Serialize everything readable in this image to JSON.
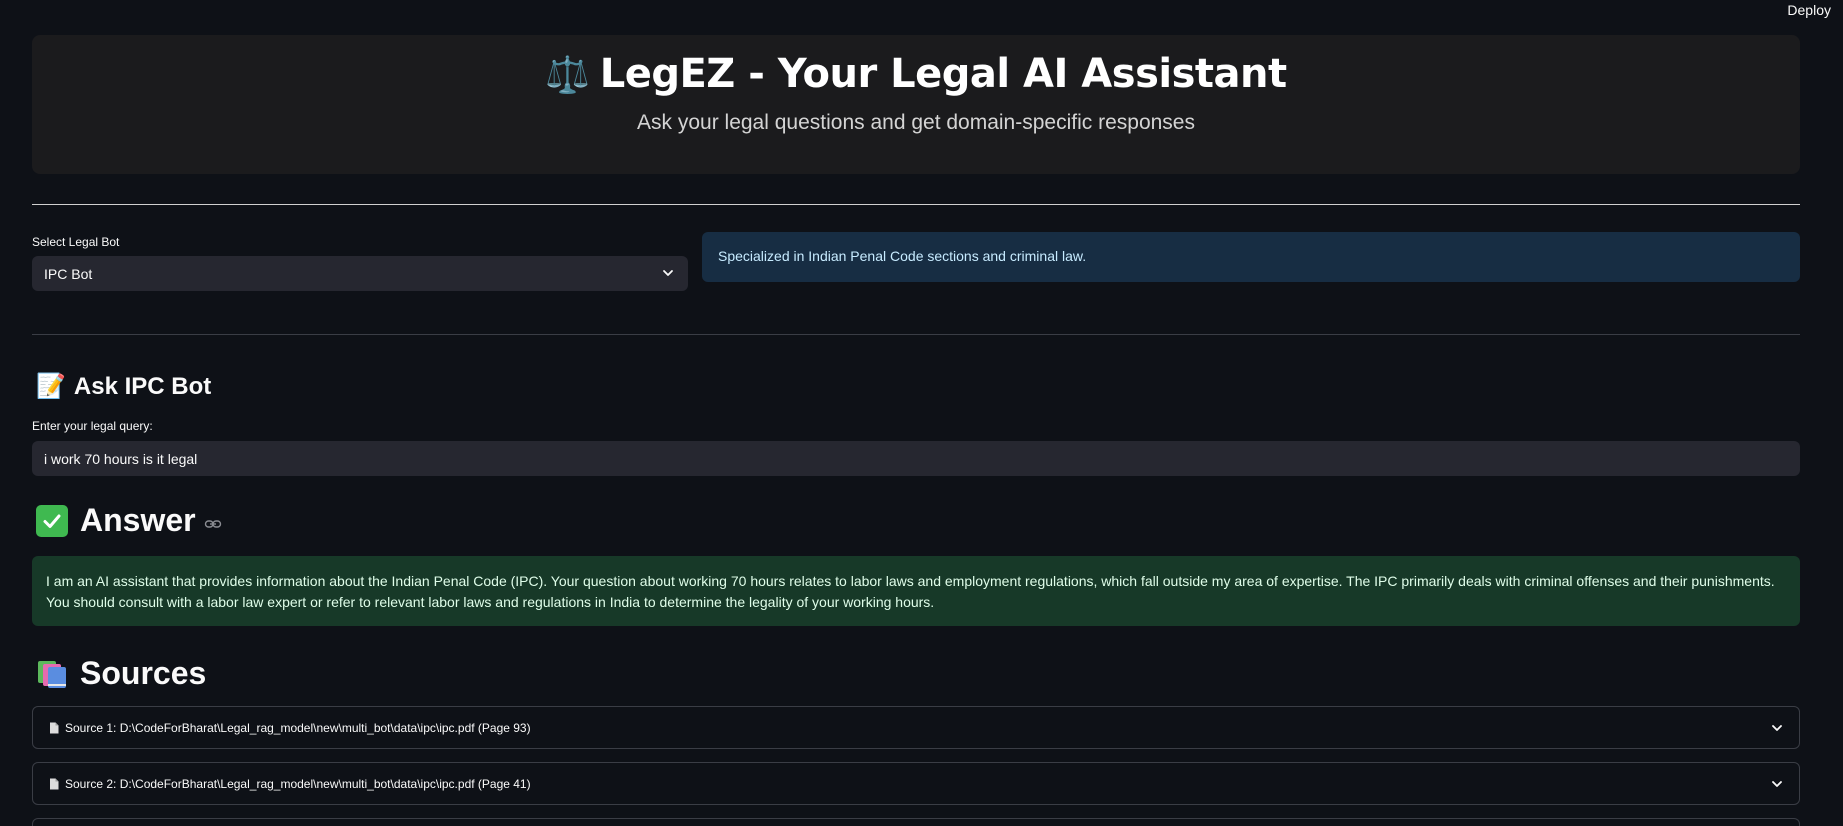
{
  "toolbar": {
    "deploy_label": "Deploy"
  },
  "header": {
    "title_emoji": "⚖️",
    "title": "LegEZ - Your Legal AI Assistant",
    "subtitle": "Ask your legal questions and get domain-specific responses"
  },
  "bot_select": {
    "label": "Select Legal Bot",
    "selected_value": "IPC Bot"
  },
  "bot_info": {
    "text": "Specialized in Indian Penal Code sections and criminal law."
  },
  "ask": {
    "emoji": "📝",
    "heading": "Ask IPC Bot",
    "query_label": "Enter your legal query:",
    "query_value": "i work 70 hours is it legal"
  },
  "answer": {
    "heading": "Answer",
    "text": "I am an AI assistant that provides information about the Indian Penal Code (IPC). Your question about working 70 hours relates to labor laws and employment regulations, which fall outside my area of expertise. The IPC primarily deals with criminal offenses and their punishments. You should consult with a labor law expert or refer to relevant labor laws and regulations in India to determine the legality of your working hours."
  },
  "sources": {
    "heading": "Sources",
    "items": [
      {
        "label": "Source 1: D:\\CodeForBharat\\Legal_rag_model\\new\\multi_bot\\data\\ipc\\ipc.pdf (Page 93)"
      },
      {
        "label": "Source 2: D:\\CodeForBharat\\Legal_rag_model\\new\\multi_bot\\data\\ipc\\ipc.pdf (Page 41)"
      }
    ]
  },
  "colors": {
    "background": "#0e1117",
    "info_bg": "#172d43",
    "success_bg": "#173928",
    "input_bg": "#262730"
  }
}
